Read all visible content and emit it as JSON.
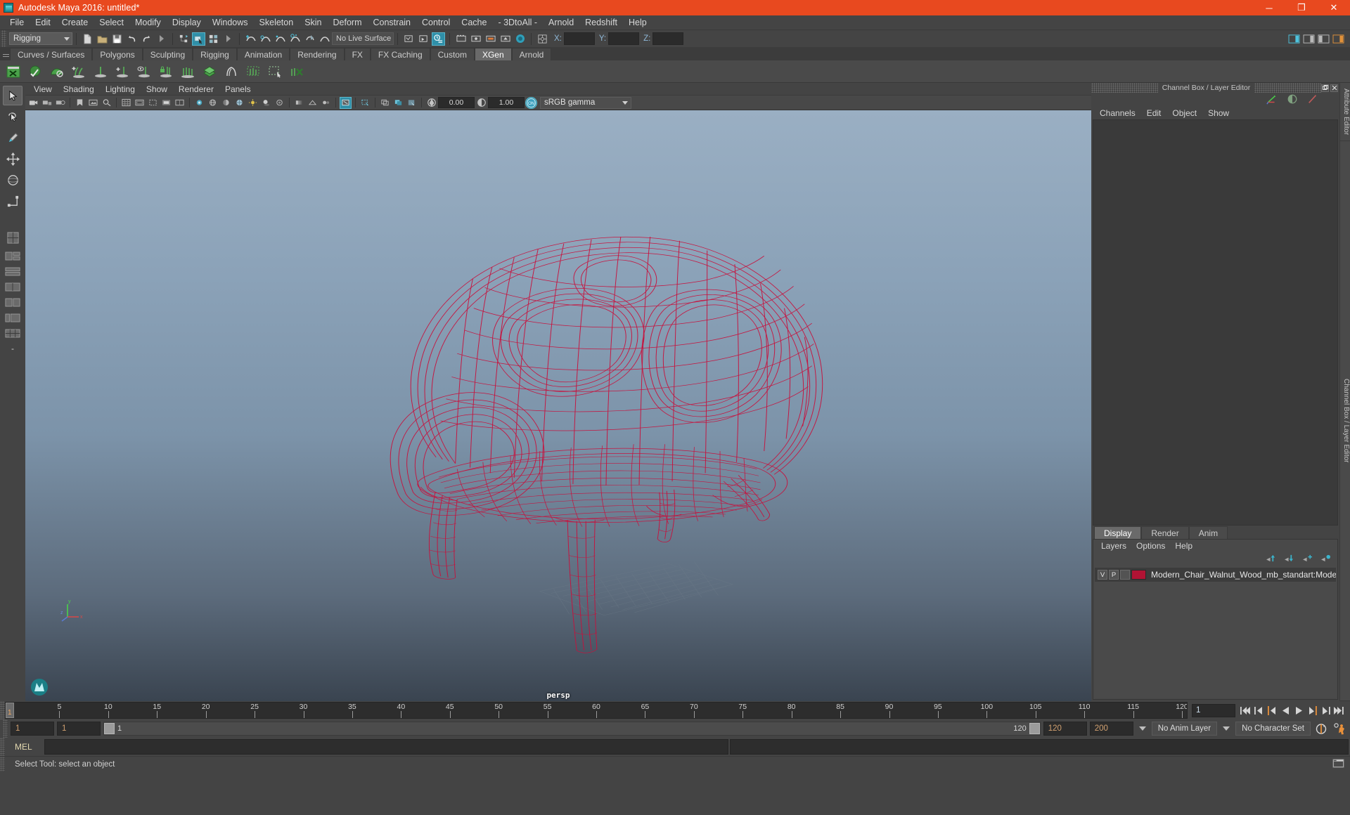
{
  "window": {
    "title": "Autodesk Maya 2016: untitled*",
    "logo_icon": "maya-logo-icon",
    "minimize": "─",
    "maximize": "❐",
    "close": "✕"
  },
  "menubar": {
    "items": [
      "File",
      "Edit",
      "Create",
      "Select",
      "Modify",
      "Display",
      "Windows",
      "Skeleton",
      "Skin",
      "Deform",
      "Constrain",
      "Control",
      "Cache",
      "- 3DtoAll -",
      "Arnold",
      "Redshift",
      "Help"
    ]
  },
  "statusline": {
    "menuset": "Rigging",
    "live_surface": "No Live Surface",
    "coords": {
      "x_label": "X:",
      "y_label": "Y:",
      "z_label": "Z:",
      "x_value": "",
      "y_value": "",
      "z_value": ""
    },
    "icons": [
      "new-scene-icon",
      "open-scene-icon",
      "save-scene-icon",
      "undo-icon",
      "redo-icon",
      "select-hierarchy-icon",
      "select-object-icon",
      "select-component-icon",
      "snap-grid-icon",
      "snap-curve-icon",
      "snap-point-icon",
      "snap-projected-icon",
      "snap-view-plane-icon",
      "make-live-icon",
      "render-view-icon",
      "render-current-frame-icon",
      "ipr-render-icon",
      "render-settings-icon",
      "hypershade-icon",
      "render-setup-icon",
      "toggle-sidebar-icon",
      "attribute-editor-toggle-icon",
      "tool-settings-toggle-icon",
      "channel-box-toggle-icon"
    ]
  },
  "shelf": {
    "tabs": [
      "Curves / Surfaces",
      "Polygons",
      "Sculpting",
      "Rigging",
      "Animation",
      "Rendering",
      "FX",
      "FX Caching",
      "Custom",
      "XGen",
      "Arnold"
    ],
    "active_tab": "XGen",
    "icons": [
      "xgen-editor-icon",
      "xgen-sphere-icon",
      "xgen-dome-icon",
      "xgen-add-guide-icon",
      "xgen-guide-icon",
      "xgen-add-icon",
      "xgen-eye-icon",
      "xgen-lock-icon",
      "xgen-comb-icon",
      "xgen-density-icon",
      "xgen-clump-icon",
      "xgen-noise-icon",
      "xgen-region-icon",
      "xgen-delete-icon"
    ]
  },
  "toolbox": {
    "items": [
      "select-tool",
      "lasso-select-tool",
      "paint-select-tool",
      "move-tool",
      "rotate-tool",
      "scale-tool",
      "soft-modification-tool",
      "show-manipulator-tool",
      "last-tool-used"
    ],
    "layouts": [
      "single-pane-layout",
      "two-pane-side-layout",
      "two-pane-stacked-layout",
      "three-pane-layout",
      "four-pane-layout",
      "persp-outliner-layout",
      "hypergraph-layout"
    ],
    "active": "select-tool",
    "bookmark_label": "-"
  },
  "viewport_panel": {
    "menus": [
      "View",
      "Shading",
      "Lighting",
      "Show",
      "Renderer",
      "Panels"
    ],
    "toolbar": {
      "exposure": "0.00",
      "gamma": "1.00",
      "color_management": "sRGB gamma",
      "gate_toggle": "ON",
      "icons": [
        "select-camera-icon",
        "lock-camera-icon",
        "camera-attributes-icon",
        "bookmark-icon",
        "image-plane-icon",
        "two-dimensional-pan-zoom-icon",
        "grid-toggle-icon",
        "film-gate-icon",
        "resolution-gate-icon",
        "gate-mask-icon",
        "film-origin-icon",
        "xray-joints-icon",
        "wireframe-shading-icon",
        "smooth-shade-all-icon",
        "smooth-shade-textured-icon",
        "use-all-lights-icon",
        "shadows-icon",
        "screen-space-ao-icon",
        "motion-blur-icon",
        "multisample-aa-icon",
        "depth-of-field-icon",
        "isolate-select-icon",
        "xray-mode-icon",
        "xray-active-components-icon",
        "exposure-icon",
        "gamma-icon",
        "color-management-icon"
      ]
    },
    "camera_label": "persp",
    "axis_labels": {
      "x": "x",
      "y": "y",
      "z": "z"
    },
    "background_top": "#9aafc3",
    "background_bottom": "#3a4450",
    "wireframe_color": "#c8103c"
  },
  "channel_box": {
    "panel_title": "Channel Box / Layer Editor",
    "menus": [
      "Channels",
      "Edit",
      "Object",
      "Show"
    ],
    "undock_icon": "undock-icon",
    "close_icon": "close-icon",
    "toolbar_icons": [
      "channel-box-icon",
      "layer-editor-icon",
      "attribute-editor-icon"
    ],
    "content": ""
  },
  "layer_editor": {
    "tabs": [
      "Display",
      "Render",
      "Anim"
    ],
    "active_tab": "Display",
    "menus": [
      "Layers",
      "Options",
      "Help"
    ],
    "buttons": [
      "move-layer-up-icon",
      "move-layer-down-icon",
      "create-empty-layer-icon",
      "create-layer-from-selected-icon"
    ],
    "layers": [
      {
        "visibility": "V",
        "playback": "P",
        "state": "",
        "color": "#b01334",
        "name": "Modern_Chair_Walnut_Wood_mb_standart:Modern_Cha"
      }
    ]
  },
  "side_tabs": [
    "Attribute Editor",
    "Channel Box / Layer Editor"
  ],
  "timeline": {
    "start_frame": "1",
    "end_frame": "120",
    "current_frame": "1",
    "tick_labels": [
      "5",
      "10",
      "15",
      "20",
      "25",
      "30",
      "35",
      "40",
      "45",
      "50",
      "55",
      "60",
      "65",
      "70",
      "75",
      "80",
      "85",
      "90",
      "95",
      "100",
      "105",
      "110",
      "115",
      "120"
    ],
    "playback_buttons": [
      "go-to-start-icon",
      "step-back-keyframe-icon",
      "step-back-frame-icon",
      "play-backwards-icon",
      "play-forwards-icon",
      "step-forward-frame-icon",
      "step-forward-keyframe-icon",
      "go-to-end-icon"
    ]
  },
  "range_slider": {
    "anim_start": "1",
    "range_start": "1",
    "slider_start_value": "1",
    "slider_end_value": "120",
    "range_end": "120",
    "anim_end": "200",
    "anim_layer": "No Anim Layer",
    "character_set": "No Character Set",
    "auto_key_icon": "auto-keyframe-icon",
    "anim_prefs_icon": "animation-preferences-icon"
  },
  "command_line": {
    "language": "MEL",
    "input_value": "",
    "script_editor_icon": "script-editor-icon"
  },
  "status_bar": {
    "message": "Select Tool: select an object",
    "help_icon": "help-icon"
  }
}
